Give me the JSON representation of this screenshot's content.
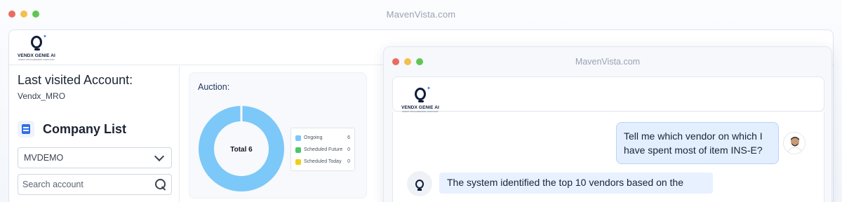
{
  "browser": {
    "url": "MavenVista.com"
  },
  "brand": {
    "name": "VENDX GENIE AI",
    "tagline": "SMART PROCUREMENT ASSISTANT"
  },
  "left_panel": {
    "last_visited_label": "Last visited Account:",
    "last_visited_value": "Vendx_MRO",
    "company_list_title": "Company List",
    "company_select_value": "MVDEMO",
    "search_placeholder": "Search account"
  },
  "auction": {
    "title": "Auction:",
    "total_label": "Total 6",
    "legend": [
      {
        "label": "Ongoing",
        "value": "6",
        "color": "#7cc8f8"
      },
      {
        "label": "Scheduled Future",
        "value": "0",
        "color": "#4cc76a"
      },
      {
        "label": "Scheduled Today",
        "value": "0",
        "color": "#f2cf16"
      }
    ]
  },
  "chat_window": {
    "url": "MavenVista.com",
    "user_message": "Tell me which vendor on which I have spent most of item INS-E?",
    "bot_message": "The system identified the top 10 vendors based on the"
  },
  "colors": {
    "donut_fill": "#7cc8f8",
    "accent": "#2f6fe4"
  }
}
